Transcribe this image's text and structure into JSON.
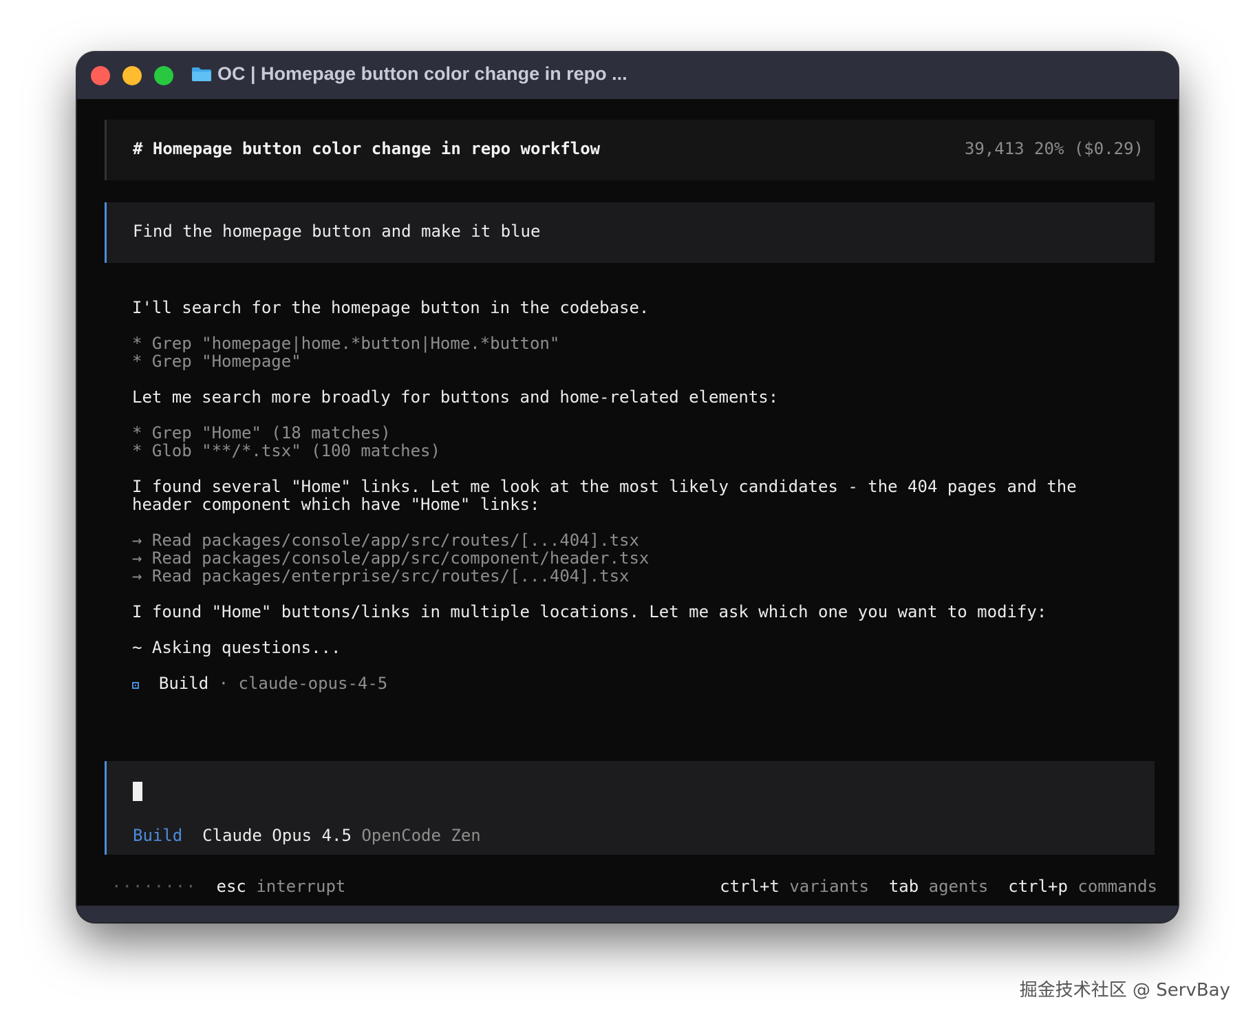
{
  "window": {
    "title": "OC | Homepage button color change in repo ...",
    "icon": "folder-icon"
  },
  "header": {
    "title": "# Homepage button color change in repo workflow",
    "tokens": "39,413",
    "usage": "20% ($0.29)"
  },
  "prompt": {
    "text": "Find the homepage button and make it blue"
  },
  "transcript": {
    "msg1": "I'll search for the homepage button in the codebase.",
    "tool1_mark": "*",
    "tool1": "Grep \"homepage|home.*button|Home.*button\"",
    "tool2_mark": "*",
    "tool2": "Grep \"Homepage\"",
    "msg2": "Let me search more broadly for buttons and home-related elements:",
    "tool3_mark": "*",
    "tool3": "Grep \"Home\" (18 matches)",
    "tool4_mark": "*",
    "tool4": "Glob \"**/*.tsx\" (100 matches)",
    "msg3_line1": "I found several \"Home\" links. Let me look at the most likely candidates - the 404 pages and the",
    "msg3_line2": "header component which have \"Home\" links:",
    "read1_mark": "→",
    "read1": "Read packages/console/app/src/routes/[...404].tsx",
    "read2_mark": "→",
    "read2": "Read packages/console/app/src/component/header.tsx",
    "read3_mark": "→",
    "read3": "Read packages/enterprise/src/routes/[...404].tsx",
    "msg4": "I found \"Home\" buttons/links in multiple locations. Let me ask which one you want to modify:",
    "asking": "~ Asking questions...",
    "build_label": "Build",
    "build_sep": "·",
    "build_model": "claude-opus-4-5"
  },
  "input": {
    "mode": "Build",
    "model": "Claude Opus 4.5",
    "provider": "OpenCode Zen"
  },
  "status": {
    "dots": "········",
    "esc_key": "esc",
    "esc_label": "interrupt",
    "variants_key": "ctrl+t",
    "variants_label": "variants",
    "agents_key": "tab",
    "agents_label": "agents",
    "commands_key": "ctrl+p",
    "commands_label": "commands"
  },
  "watermark": "掘金技术社区 @ ServBay",
  "colors": {
    "accent": "#4d8ddb",
    "background": "#0b0b0c",
    "titlebar": "#2e2f3d"
  }
}
